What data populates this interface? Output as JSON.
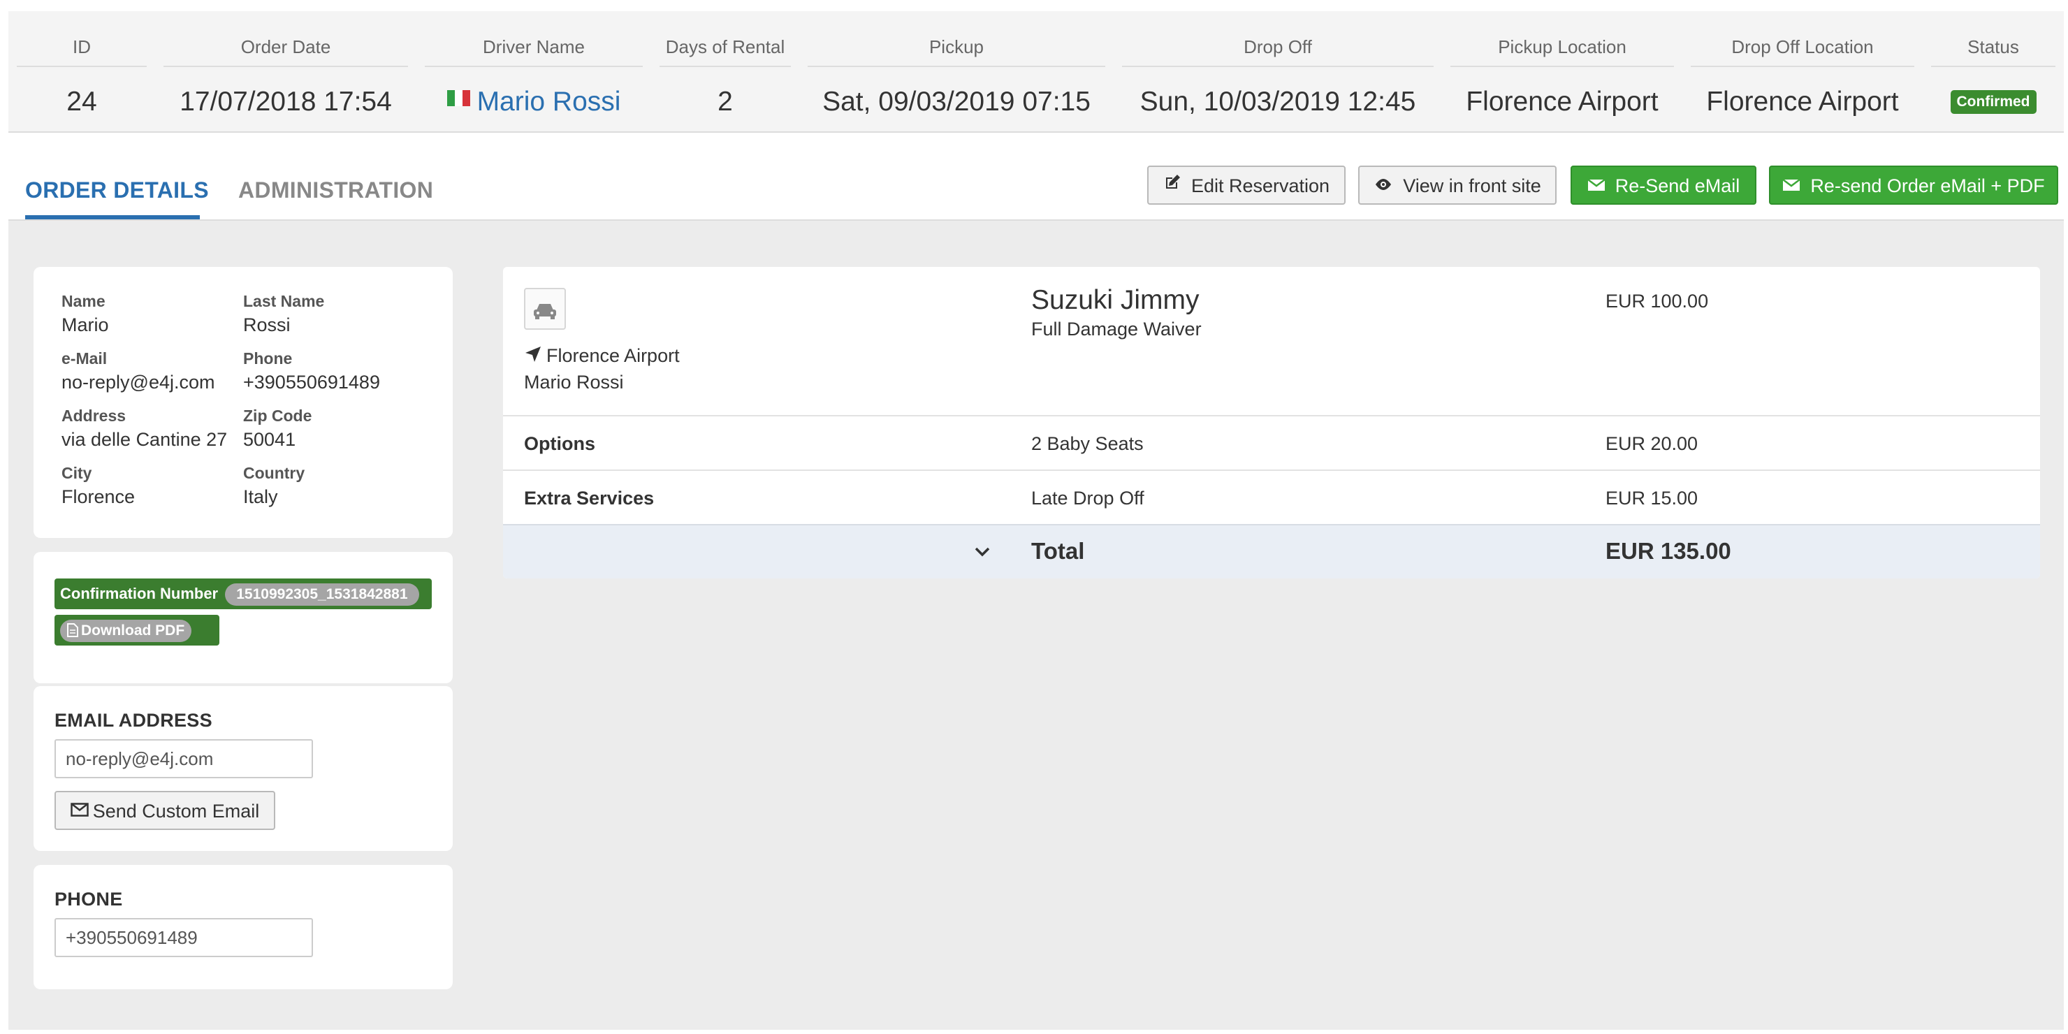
{
  "summary": {
    "columns": [
      {
        "header": "ID",
        "value": "24"
      },
      {
        "header": "Order Date",
        "value": "17/07/2018 17:54"
      },
      {
        "header": "Driver Name",
        "value": "Mario Rossi"
      },
      {
        "header": "Days of Rental",
        "value": "2"
      },
      {
        "header": "Pickup",
        "value": "Sat, 09/03/2019 07:15"
      },
      {
        "header": "Drop Off",
        "value": "Sun, 10/03/2019 12:45"
      },
      {
        "header": "Pickup Location",
        "value": "Florence Airport"
      },
      {
        "header": "Drop Off Location",
        "value": "Florence Airport"
      },
      {
        "header": "Status",
        "value": "Confirmed"
      }
    ],
    "driver_flag": "italy-flag-icon",
    "colors": {
      "link": "#2a6fb0",
      "status": "#3b8c2f"
    }
  },
  "tabs": {
    "order_details": "ORDER DETAILS",
    "administration": "ADMINISTRATION"
  },
  "actions": {
    "edit": "Edit Reservation",
    "view_front": "View in front site",
    "resend_email": "Re-Send eMail",
    "resend_pdf": "Re-send Order eMail + PDF"
  },
  "customer": {
    "fields": [
      {
        "label": "Name",
        "value": "Mario"
      },
      {
        "label": "Last Name",
        "value": "Rossi"
      },
      {
        "label": "e-Mail",
        "value": "no-reply@e4j.com"
      },
      {
        "label": "Phone",
        "value": "+390550691489"
      },
      {
        "label": "Address",
        "value": "via delle Cantine 27"
      },
      {
        "label": "Zip Code",
        "value": "50041"
      },
      {
        "label": "City",
        "value": "Florence"
      },
      {
        "label": "Country",
        "value": "Italy"
      }
    ]
  },
  "confirmation": {
    "label": "Confirmation Number",
    "number": "1510992305_1531842881",
    "download": "Download PDF"
  },
  "email_section": {
    "title": "EMAIL ADDRESS",
    "value": "no-reply@e4j.com",
    "button": "Send Custom Email"
  },
  "phone_section": {
    "title": "PHONE",
    "value": "+390550691489"
  },
  "order": {
    "car_name": "Suzuki Jimmy",
    "car_subtitle": "Full Damage Waiver",
    "car_price": "EUR 100.00",
    "pickup_location": "Florence Airport",
    "driver": "Mario Rossi",
    "rows": [
      {
        "label": "Options",
        "desc": "2 Baby Seats",
        "price": "EUR 20.00"
      },
      {
        "label": "Extra Services",
        "desc": "Late Drop Off",
        "price": "EUR 15.00"
      }
    ],
    "total_label": "Total",
    "total_value": "EUR 135.00"
  }
}
